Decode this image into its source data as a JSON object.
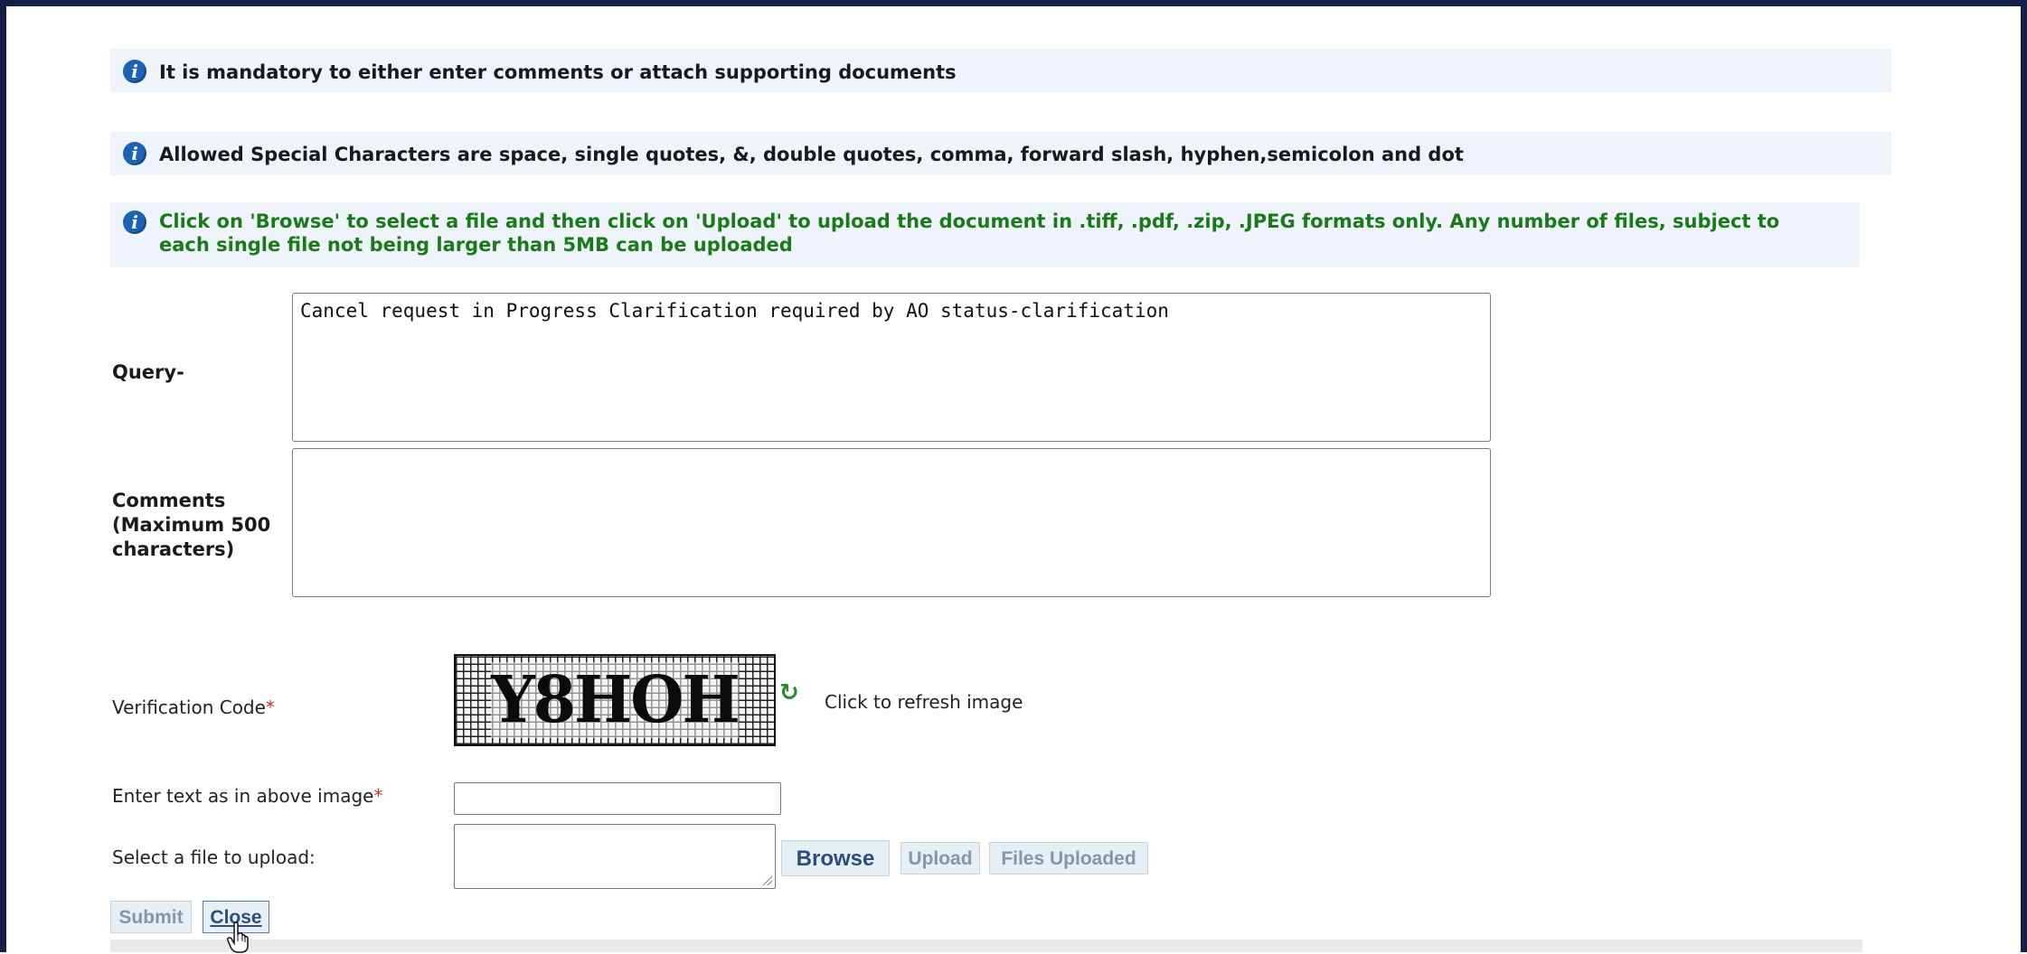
{
  "notices": [
    {
      "text": "It is mandatory to either enter comments or attach supporting documents",
      "color": "#1a1a1a"
    },
    {
      "text": "Allowed Special Characters are space, single quotes, &, double quotes, comma, forward slash, hyphen,semicolon and dot",
      "color": "#1a1a1a"
    },
    {
      "line1": "Click on 'Browse' to select a file and then click on 'Upload' to upload the document in .tiff, .pdf, .zip, .JPEG formats only. Any number of files, subject to",
      "line2": "each single file not being larger than 5MB can be uploaded",
      "color": "#1a7a1a"
    }
  ],
  "form": {
    "query_label": "Query-",
    "query_value": "Cancel request in Progress Clarification required by AO status-clarification",
    "comments_label_1": "Comments",
    "comments_label_2": "(Maximum 500",
    "comments_label_3": "characters)",
    "comments_value": "",
    "verification_label": "Verification Code",
    "required_mark": "*",
    "captcha_text": "Y8HOH",
    "refresh_text": "Click to refresh image",
    "enter_text_label": "Enter text as in above image",
    "enter_text_value": "",
    "file_label": "Select a file to upload:"
  },
  "buttons": {
    "browse": "Browse",
    "upload": "Upload",
    "files_uploaded": "Files Uploaded",
    "submit": "Submit",
    "close": "Close"
  },
  "colors": {
    "frame": "#15204a",
    "info_bg": "#eef4fa",
    "info_icon": "#1c63b8",
    "green_text": "#1a7a1a",
    "required": "#d03030"
  }
}
